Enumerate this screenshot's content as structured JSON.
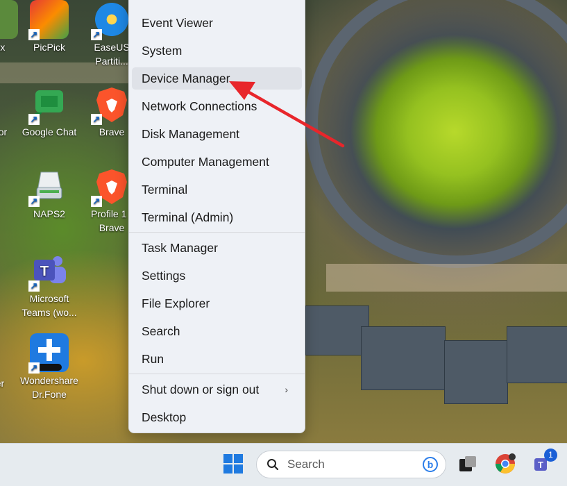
{
  "desktop": {
    "icons": [
      {
        "label": "tex"
      },
      {
        "label": "PicPick"
      },
      {
        "label": "EaseUS Partiti..."
      },
      {
        "label": "or"
      },
      {
        "label": "Google Chat"
      },
      {
        "label": "Brave"
      },
      {
        "label": "NAPS2"
      },
      {
        "label": "Profile 1 - Brave"
      },
      {
        "label": "Microsoft Teams (wo..."
      },
      {
        "label": "er"
      },
      {
        "label": "Wondershare Dr.Fone"
      }
    ]
  },
  "context_menu": {
    "items": [
      {
        "label": "Event Viewer"
      },
      {
        "label": "System"
      },
      {
        "label": "Device Manager",
        "highlighted": true
      },
      {
        "label": "Network Connections"
      },
      {
        "label": "Disk Management"
      },
      {
        "label": "Computer Management"
      },
      {
        "label": "Terminal"
      },
      {
        "label": "Terminal (Admin)"
      },
      {
        "label": "Task Manager"
      },
      {
        "label": "Settings"
      },
      {
        "label": "File Explorer"
      },
      {
        "label": "Search"
      },
      {
        "label": "Run"
      },
      {
        "label": "Shut down or sign out",
        "submenu": true
      },
      {
        "label": "Desktop"
      }
    ]
  },
  "annotation": {
    "color": "#e8262b"
  },
  "taskbar": {
    "search_placeholder": "Search",
    "teams_badge": "1",
    "colors": {
      "windows_blue": "#1f7ae0",
      "teams_purple": "#5b5fc7",
      "badge_blue": "#1a5fd6"
    }
  }
}
